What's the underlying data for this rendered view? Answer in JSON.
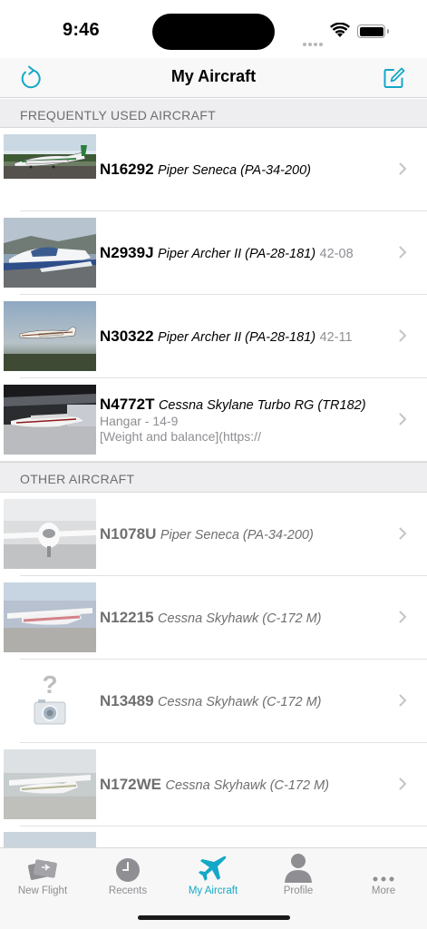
{
  "status_bar": {
    "time": "9:46"
  },
  "nav": {
    "title": "My Aircraft",
    "refresh_icon": "refresh-icon",
    "compose_icon": "compose-icon"
  },
  "accent_color": "#13a8c8",
  "sections": [
    {
      "header": "FREQUENTLY USED AIRCRAFT",
      "rows": [
        {
          "tail": "N16292",
          "model": "Piper Seneca (PA-34-200)",
          "suffix": "",
          "sub1": "",
          "sub2": ""
        },
        {
          "tail": "N2939J",
          "model": "Piper Archer II (PA-28-181)",
          "suffix": "42-08",
          "sub1": "",
          "sub2": ""
        },
        {
          "tail": "N30322",
          "model": "Piper Archer II (PA-28-181)",
          "suffix": "42-11",
          "sub1": "",
          "sub2": ""
        },
        {
          "tail": "N4772T",
          "model": "Cessna Skylane Turbo RG (TR182)",
          "suffix": "",
          "sub1": "Hangar - 14-9",
          "sub2": "[Weight and balance](https://"
        }
      ]
    },
    {
      "header": "OTHER AIRCRAFT",
      "rows": [
        {
          "tail": "N1078U",
          "model": "Piper Seneca (PA-34-200)",
          "suffix": ""
        },
        {
          "tail": "N12215",
          "model": "Cessna Skyhawk (C-172 M)",
          "suffix": ""
        },
        {
          "tail": "N13489",
          "model": "Cessna Skyhawk (C-172 M)",
          "suffix": ""
        },
        {
          "tail": "N172WE",
          "model": "Cessna Skyhawk (C-172 M)",
          "suffix": ""
        }
      ]
    }
  ],
  "tabs": [
    {
      "label": "New Flight",
      "icon": "new-flight-icon"
    },
    {
      "label": "Recents",
      "icon": "clock-icon"
    },
    {
      "label": "My Aircraft",
      "icon": "airplane-icon",
      "active": true
    },
    {
      "label": "Profile",
      "icon": "profile-icon"
    },
    {
      "label": "More",
      "icon": "more-icon"
    }
  ]
}
